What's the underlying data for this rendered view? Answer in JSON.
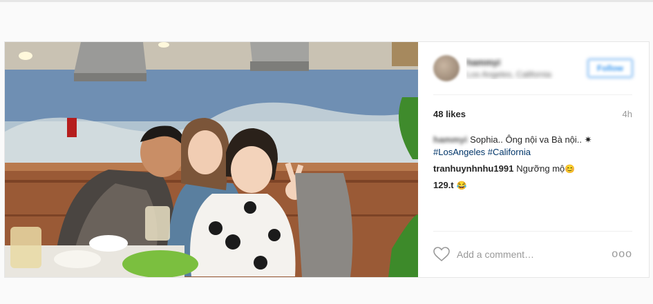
{
  "post": {
    "header": {
      "username": "hammyi",
      "location": "Los Angeles, California",
      "follow_label": "Follow"
    },
    "likes": "48 likes",
    "time": "4h",
    "caption": {
      "username": "hammyi",
      "text": "Sophia.. Ông nội va Bà nội.. ✷",
      "hashtags": [
        "#LosAngeles",
        "#California"
      ]
    },
    "comments": [
      {
        "username": "tranhuynhnhu1991",
        "text": "Ngưỡng mộ",
        "emoji": "😊"
      },
      {
        "username": "",
        "text": "129.t",
        "emoji": "😂"
      }
    ],
    "comment_placeholder": "Add a comment…",
    "more_label": "ooo"
  },
  "icons": {
    "like": "heart-icon",
    "more": "more-options-icon"
  }
}
